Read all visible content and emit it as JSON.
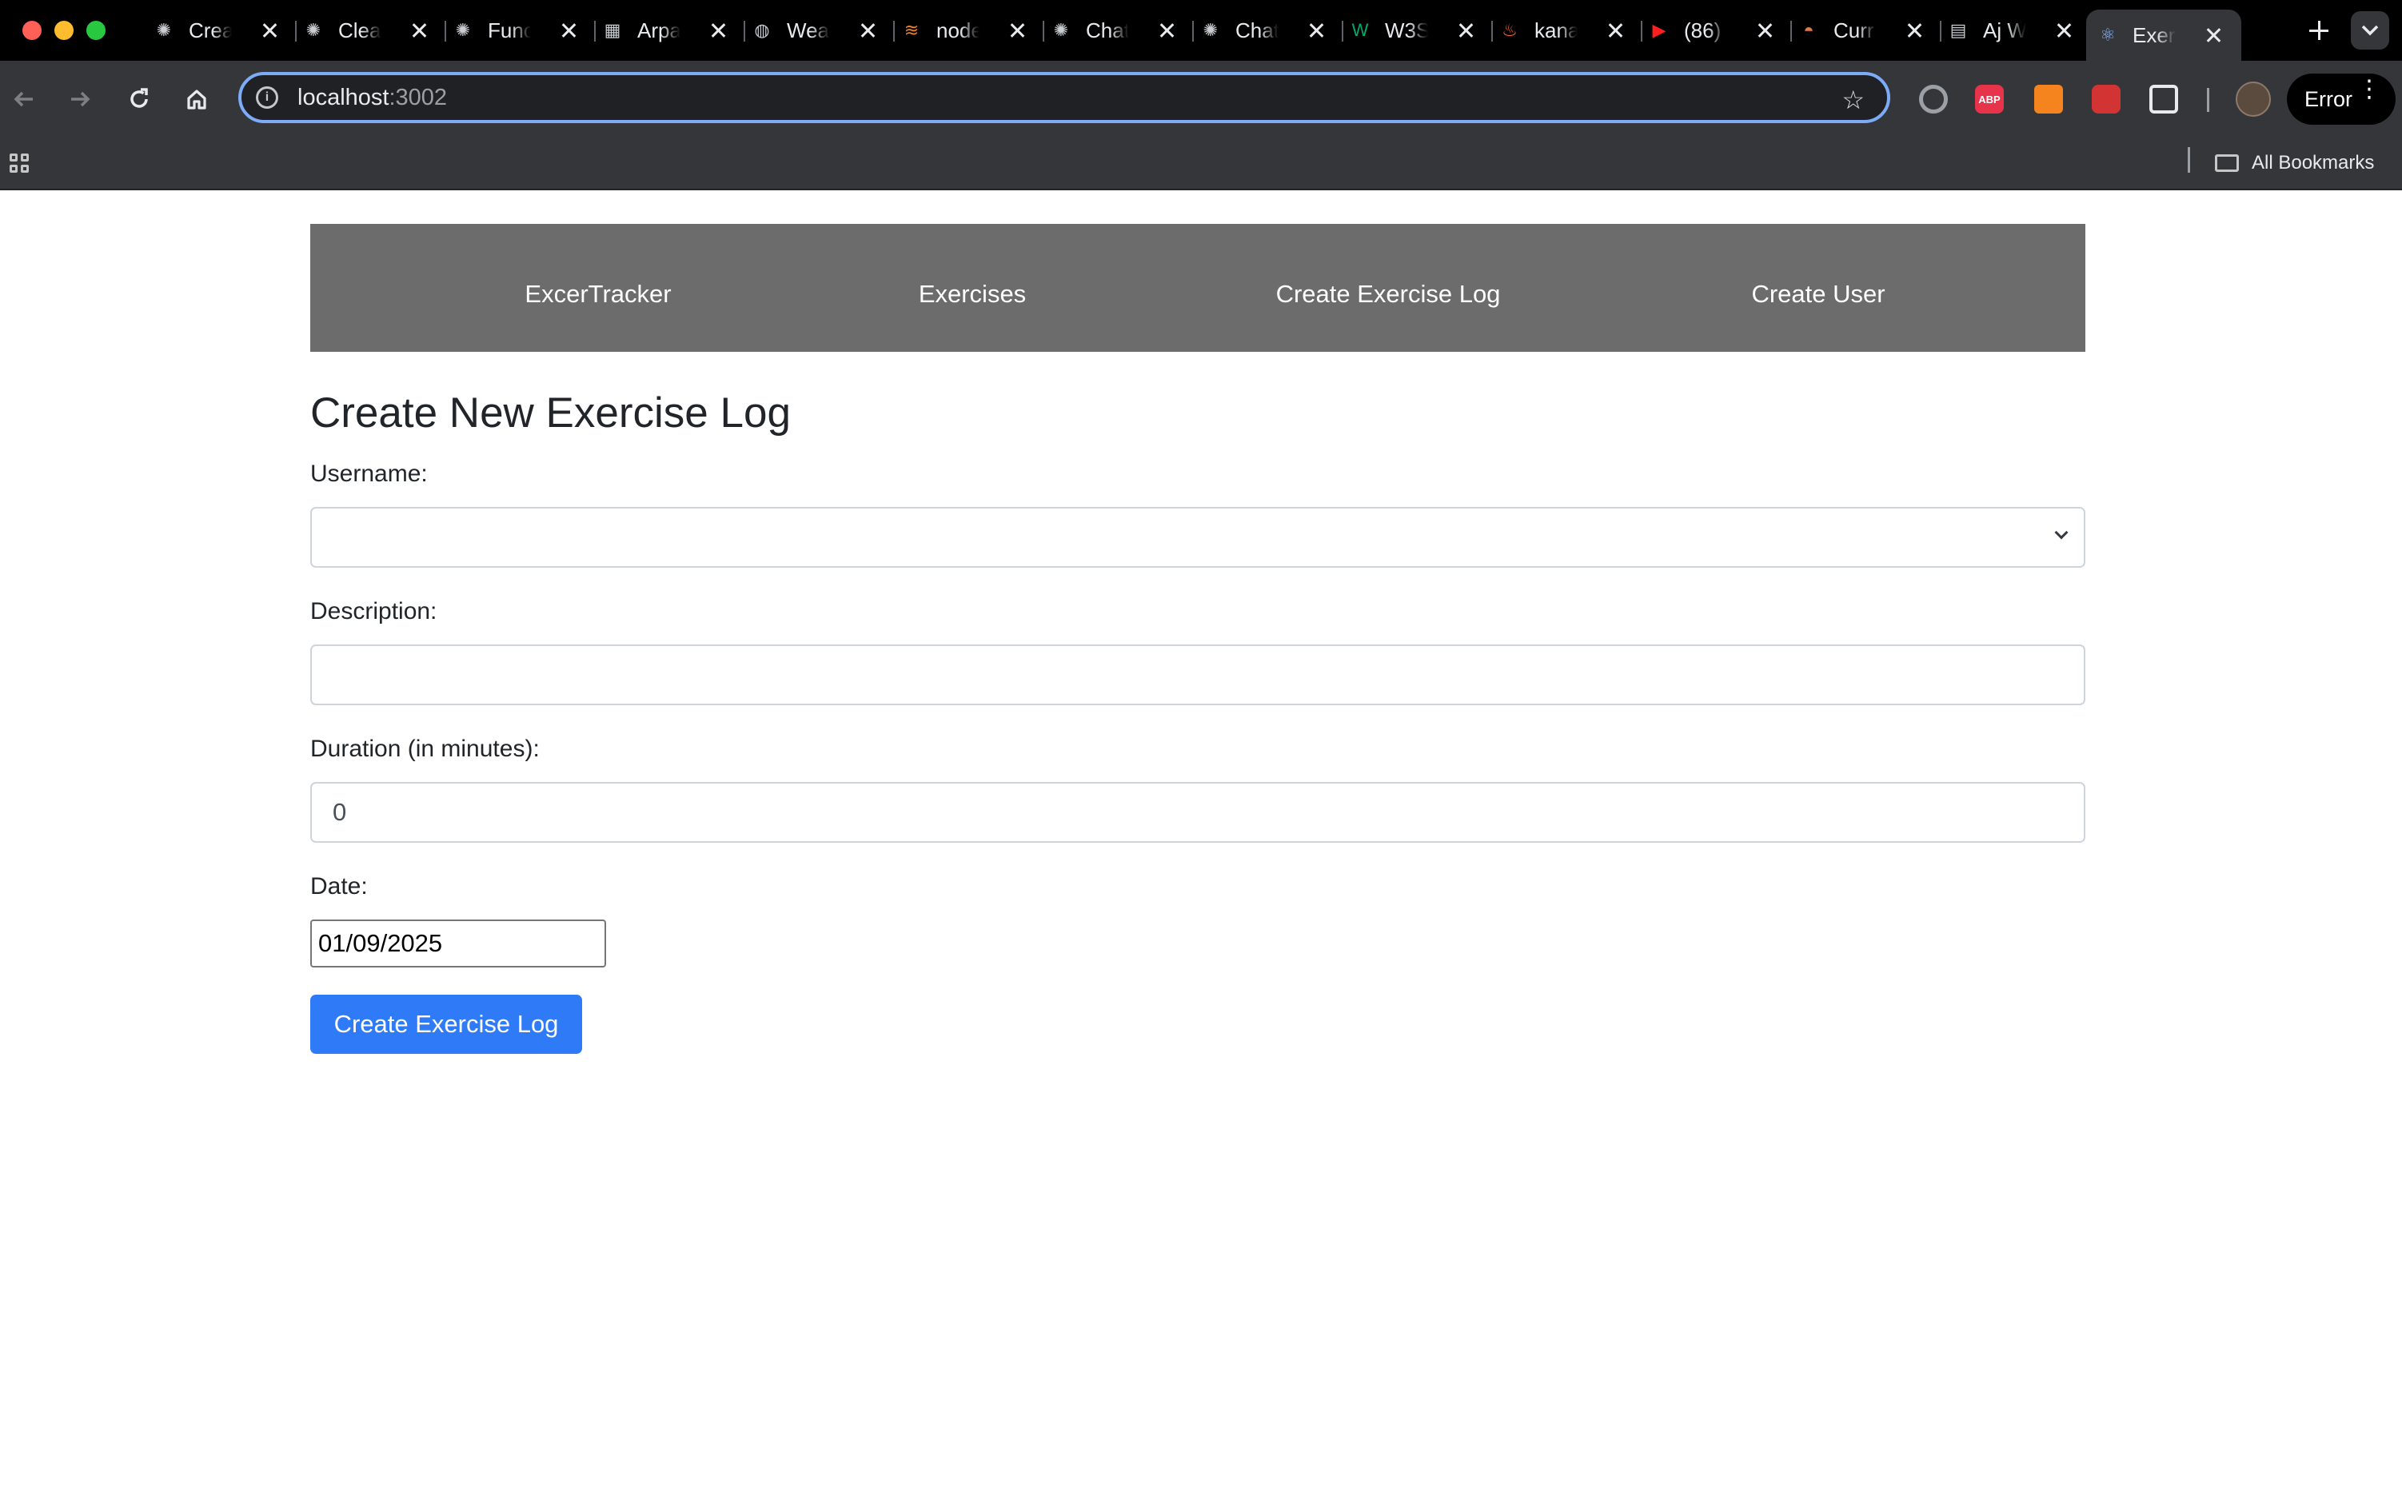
{
  "browser": {
    "tabs": [
      {
        "title": "Create",
        "icon": "openai-icon"
      },
      {
        "title": "Clean",
        "icon": "openai-icon"
      },
      {
        "title": "Func",
        "icon": "openai-icon"
      },
      {
        "title": "Arpan",
        "icon": "arpan-icon"
      },
      {
        "title": "Weat",
        "icon": "globe-icon"
      },
      {
        "title": "node",
        "icon": "stackoverflow-icon"
      },
      {
        "title": "Chat",
        "icon": "openai-icon"
      },
      {
        "title": "Chat",
        "icon": "openai-icon"
      },
      {
        "title": "W3S",
        "icon": "w3schools-icon"
      },
      {
        "title": "kana",
        "icon": "fire-icon"
      },
      {
        "title": "(86)",
        "icon": "youtube-icon"
      },
      {
        "title": "Curr",
        "icon": "helmet-icon"
      },
      {
        "title": "Aj W",
        "icon": "document-icon"
      },
      {
        "title": "Exer",
        "icon": "react-icon",
        "active": true
      }
    ],
    "url_host": "localhost",
    "url_port": ":3002",
    "profile_button_label": "Error",
    "bookmarks_folder_label": "All Bookmarks",
    "extensions": [
      "grammarly-icon",
      "adblock-plus-icon",
      "metamask-icon",
      "extension-red-icon",
      "extensions-puzzle-icon"
    ],
    "abp_label": "ABP",
    "accent_color": "#7cacf8"
  },
  "app": {
    "nav": {
      "brand": "ExcerTracker",
      "exercises": "Exercises",
      "create_log": "Create Exercise Log",
      "create_user": "Create User"
    },
    "form": {
      "heading": "Create New Exercise Log",
      "username_label": "Username:",
      "username_value": "",
      "description_label": "Description:",
      "description_value": "",
      "duration_label": "Duration (in minutes):",
      "duration_value": "0",
      "date_label": "Date:",
      "date_value": "01/09/2025",
      "submit_label": "Create Exercise Log"
    },
    "colors": {
      "navbar_bg": "#6c6c6c",
      "button_bg": "#2f7af6"
    }
  }
}
